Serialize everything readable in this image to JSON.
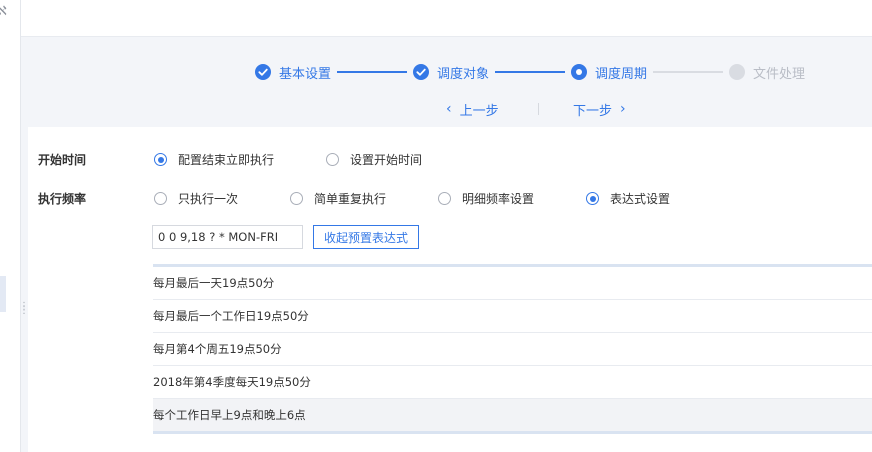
{
  "steps": [
    {
      "label": "基本设置",
      "status": "done"
    },
    {
      "label": "调度对象",
      "status": "done"
    },
    {
      "label": "调度周期",
      "status": "current"
    },
    {
      "label": "文件处理",
      "status": "pending"
    }
  ],
  "nav": {
    "prev": "上一步",
    "next": "下一步",
    "prev_icon": "chevron-left-icon",
    "next_icon": "chevron-right-icon"
  },
  "start_time": {
    "label": "开始时间",
    "options": [
      {
        "label": "配置结束立即执行",
        "checked": true
      },
      {
        "label": "设置开始时间",
        "checked": false
      }
    ]
  },
  "frequency": {
    "label": "执行频率",
    "options": [
      {
        "label": "只执行一次",
        "checked": false
      },
      {
        "label": "简单重复执行",
        "checked": false
      },
      {
        "label": "明细频率设置",
        "checked": false
      },
      {
        "label": "表达式设置",
        "checked": true
      }
    ]
  },
  "expression": {
    "value": "0 0 9,18 ? * MON-FRI",
    "collapse_label": "收起预置表达式"
  },
  "presets": [
    "每月最后一天19点50分",
    "每月最后一个工作日19点50分",
    "每月第4个周五19点50分",
    "2018年第4季度每天19点50分",
    "每个工作日早上9点和晚上6点"
  ],
  "colors": {
    "accent": "#3478e6",
    "pending": "#d9dce2",
    "page_bg": "#f3f5f9"
  }
}
